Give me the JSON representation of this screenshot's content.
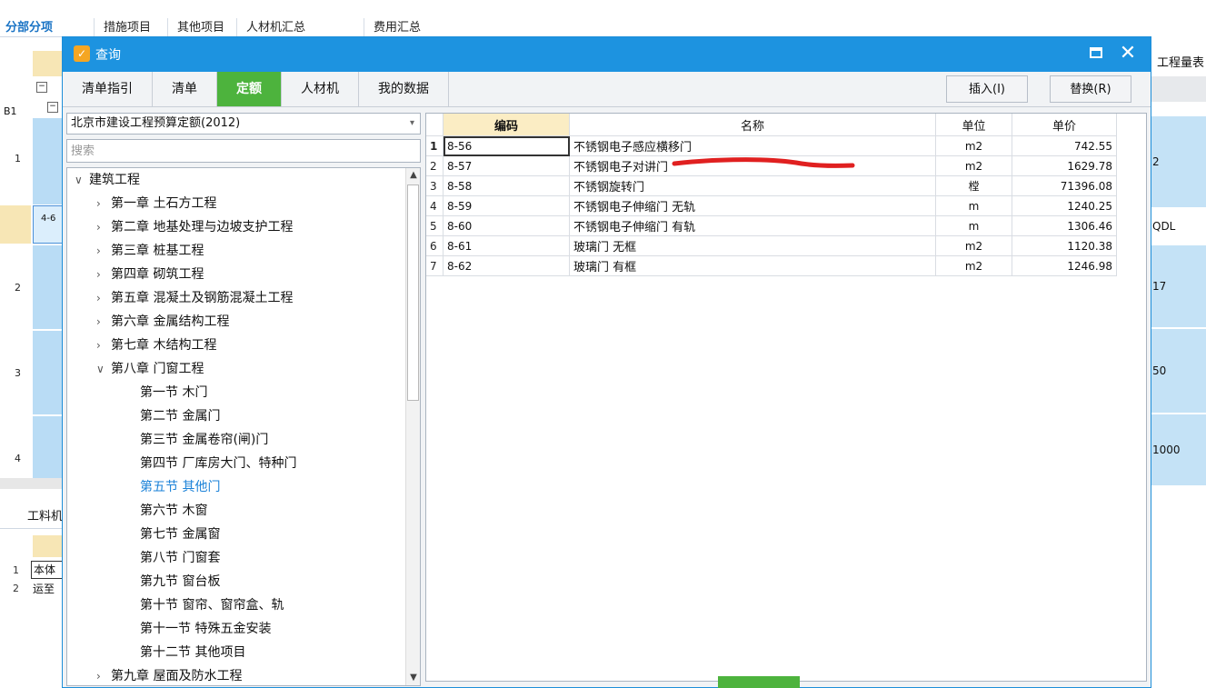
{
  "bg_tabs": [
    "分部分项",
    "措施项目",
    "其他项目",
    "人材机汇总",
    "费用汇总"
  ],
  "bg_left": {
    "label_b1": "B1",
    "rows": [
      "1",
      "2",
      "3",
      "4"
    ],
    "cell_partial": "4-6",
    "lower_title": "工料机",
    "lower_rows": [
      {
        "n": "1",
        "t": "本体"
      },
      {
        "n": "2",
        "t": "运至"
      }
    ]
  },
  "bg_right": {
    "header": "工程量表",
    "cells": [
      "2",
      "QDL",
      "17",
      "50",
      "1000"
    ]
  },
  "dialog": {
    "title": "查询",
    "tabs": [
      "清单指引",
      "清单",
      "定额",
      "人材机",
      "我的数据"
    ],
    "active_tab": "定额",
    "insert_button": "插入(I)",
    "replace_button": "替换(R)",
    "quota_library": "北京市建设工程预算定额(2012)",
    "search_placeholder": "搜索"
  },
  "tree": {
    "root": "建筑工程",
    "chapters": [
      "第一章 土石方工程",
      "第二章 地基处理与边坡支护工程",
      "第三章 桩基工程",
      "第四章 砌筑工程",
      "第五章 混凝土及钢筋混凝土工程",
      "第六章 金属结构工程",
      "第七章 木结构工程",
      "第八章 门窗工程"
    ],
    "sections": [
      "第一节 木门",
      "第二节 金属门",
      "第三节 金属卷帘(闸)门",
      "第四节 厂库房大门、特种门",
      "第五节 其他门",
      "第六节 木窗",
      "第七节 金属窗",
      "第八节 门窗套",
      "第九节 窗台板",
      "第十节 窗帘、窗帘盒、轨",
      "第十一节 特殊五金安装",
      "第十二节 其他项目"
    ],
    "selected_section": "第五节 其他门",
    "trailing_chapter": "第九章 屋面及防水工程"
  },
  "grid": {
    "headers": {
      "code": "编码",
      "name": "名称",
      "unit": "单位",
      "price": "单价"
    },
    "rows": [
      {
        "n": "1",
        "code": "8-56",
        "name": "不锈钢电子感应横移门",
        "unit": "m2",
        "price": "742.55"
      },
      {
        "n": "2",
        "code": "8-57",
        "name": "不锈钢电子对讲门",
        "unit": "m2",
        "price": "1629.78"
      },
      {
        "n": "3",
        "code": "8-58",
        "name": "不锈钢旋转门",
        "unit": "樘",
        "price": "71396.08"
      },
      {
        "n": "4",
        "code": "8-59",
        "name": "不锈钢电子伸缩门 无轨",
        "unit": "m",
        "price": "1240.25"
      },
      {
        "n": "5",
        "code": "8-60",
        "name": "不锈钢电子伸缩门 有轨",
        "unit": "m",
        "price": "1306.46"
      },
      {
        "n": "6",
        "code": "8-61",
        "name": "玻璃门 无框",
        "unit": "m2",
        "price": "1120.38"
      },
      {
        "n": "7",
        "code": "8-62",
        "name": "玻璃门 有框",
        "unit": "m2",
        "price": "1246.98"
      }
    ]
  },
  "colors": {
    "titlebar": "#1d93e0",
    "active_tab": "#4db33d",
    "code_header": "#fbedc4",
    "selected_tree_item": "#1b82d8",
    "annotation": "#e02020"
  },
  "icons": {
    "title_icon": "app-logo-icon",
    "maximize": "maximize-icon",
    "close": "close-icon",
    "expand": "chevron-down-icon",
    "collapse": "chevron-right-icon"
  }
}
